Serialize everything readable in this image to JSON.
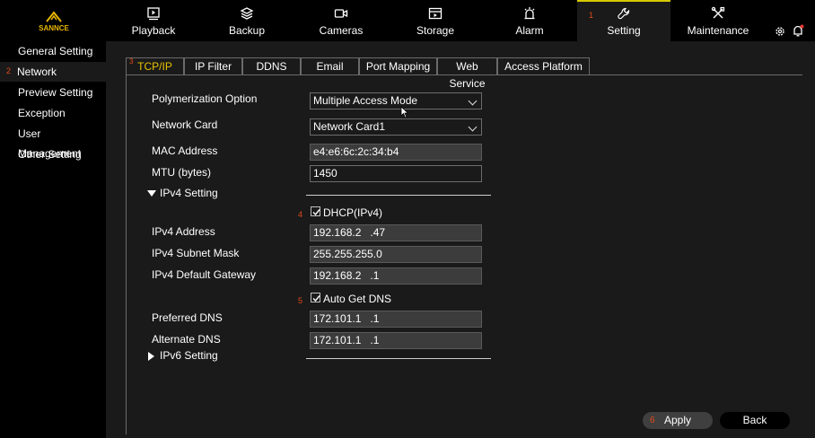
{
  "brand": {
    "logo_text": "SANNCE",
    "accent_color": "#e7b600"
  },
  "nav": {
    "items": [
      {
        "label": "Playback",
        "icon": "playback-icon"
      },
      {
        "label": "Backup",
        "icon": "layers-icon"
      },
      {
        "label": "Cameras",
        "icon": "camera-icon"
      },
      {
        "label": "Storage",
        "icon": "storage-icon"
      },
      {
        "label": "Alarm",
        "icon": "alarm-icon"
      },
      {
        "label": "Setting",
        "icon": "settings-icon",
        "badge": "1"
      },
      {
        "label": "Maintenance",
        "icon": "tools-icon"
      }
    ],
    "active": "Setting"
  },
  "sidebar": {
    "items": [
      {
        "label": "General Setting"
      },
      {
        "label": "Network",
        "badge": "2"
      },
      {
        "label": "Preview Setting"
      },
      {
        "label": "Exception"
      },
      {
        "label": "User Management"
      },
      {
        "label": "Other Setting"
      }
    ],
    "active": "Network"
  },
  "tabs": {
    "items": [
      {
        "label": "TCP/IP",
        "badge": "3"
      },
      {
        "label": "IP Filter"
      },
      {
        "label": "DDNS"
      },
      {
        "label": "Email"
      },
      {
        "label": "Port Mapping"
      },
      {
        "label": "Web Service"
      },
      {
        "label": "Access Platform"
      }
    ],
    "active": "TCP/IP"
  },
  "form": {
    "polymerization": {
      "label": "Polymerization Option",
      "value": "Multiple Access Mode"
    },
    "network_card": {
      "label": "Network Card",
      "value": "Network Card1"
    },
    "mac": {
      "label": "MAC Address",
      "value": "e4:e6:6c:2c:34:b4"
    },
    "mtu": {
      "label": "MTU (bytes)",
      "value": "1450"
    },
    "ipv4_section": "IPv4 Setting",
    "dhcp": {
      "label": "DHCP(IPv4)",
      "checked": true,
      "badge": "4"
    },
    "ipv4_address": {
      "label": "IPv4 Address",
      "value": "192.168.2   .47"
    },
    "subnet": {
      "label": "IPv4 Subnet Mask",
      "value": "255.255.255.0"
    },
    "gateway": {
      "label": "IPv4 Default Gateway",
      "value": "192.168.2   .1"
    },
    "auto_dns": {
      "label": "Auto Get DNS",
      "checked": true,
      "badge": "5"
    },
    "preferred_dns": {
      "label": "Preferred DNS",
      "value": "172.101.1   .1"
    },
    "alternate_dns": {
      "label": "Alternate DNS",
      "value": "172.101.1   .1"
    },
    "ipv6_section": "IPv6 Setting"
  },
  "buttons": {
    "apply": "Apply",
    "apply_badge": "6",
    "back": "Back"
  }
}
